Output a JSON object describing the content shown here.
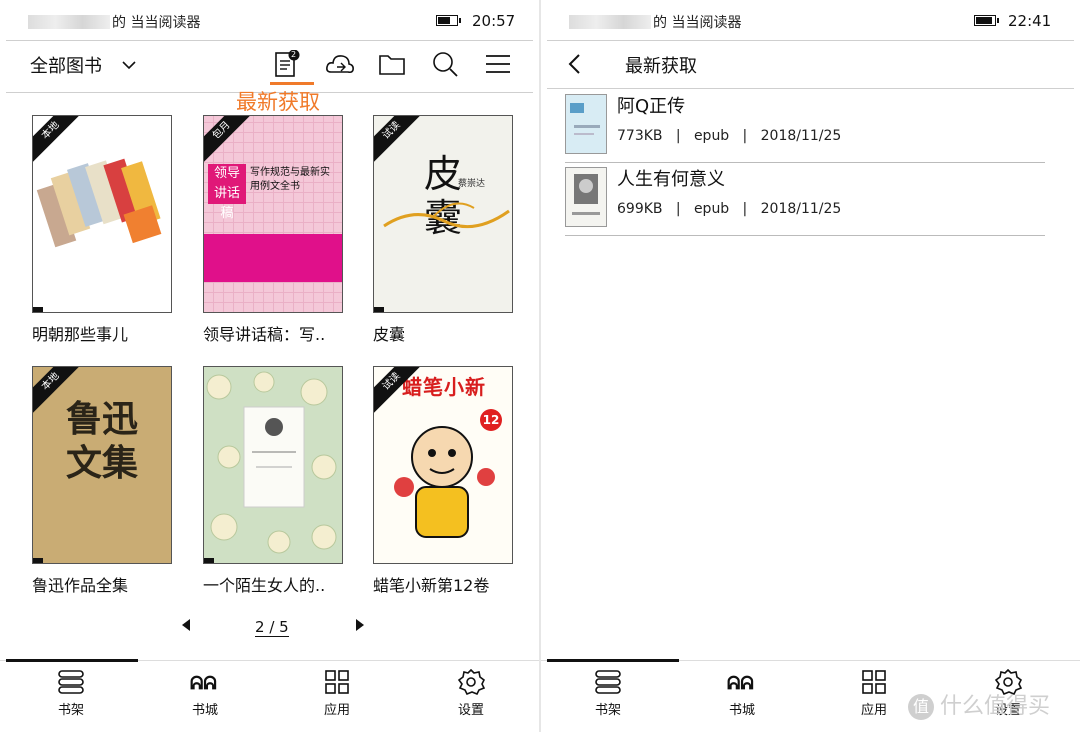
{
  "left": {
    "status": {
      "device": "的 当当阅读器",
      "time": "20:57",
      "battery": 0.75
    },
    "toolbar": {
      "title": "全部图书",
      "notes_badge": "2",
      "icons": [
        "chevron-down-icon",
        "recent-books-icon",
        "cloud-icon",
        "folder-icon",
        "search-icon",
        "menu-icon"
      ]
    },
    "annotation": "最新获取",
    "books": [
      {
        "title": "明朝那些事儿",
        "tag": "本地"
      },
      {
        "title": "领导讲话稿：写..",
        "tag": "包月",
        "cover_big": "领导讲话稿",
        "cover_sub": "写作规范与最新实用例文全书"
      },
      {
        "title": "皮囊",
        "tag": "试读",
        "cover_big": "皮囊",
        "cover_author": "蔡崇达"
      },
      {
        "title": "鲁迅作品全集",
        "tag": "本地",
        "cover_big": "鲁迅文集"
      },
      {
        "title": "一个陌生女人的..",
        "tag": ""
      },
      {
        "title": "蜡笔小新第12卷",
        "tag": "试读",
        "cover_big": "蜡笔小新",
        "cover_num": "12"
      }
    ],
    "pager": {
      "current": "2",
      "total": "5"
    }
  },
  "right": {
    "status": {
      "device": "的 当当阅读器",
      "time": "22:41",
      "battery": 1.0
    },
    "title": "最新获取",
    "items": [
      {
        "title": "阿Q正传",
        "size": "773KB",
        "format": "epub",
        "date": "2018/11/25"
      },
      {
        "title": "人生有何意义",
        "size": "699KB",
        "format": "epub",
        "date": "2018/11/25"
      }
    ]
  },
  "nav": [
    {
      "label": "书架",
      "icon": "bookshelf-icon"
    },
    {
      "label": "书城",
      "icon": "dangdang-store-icon"
    },
    {
      "label": "应用",
      "icon": "apps-grid-icon"
    },
    {
      "label": "设置",
      "icon": "settings-gear-icon"
    }
  ],
  "watermark": {
    "mark": "值",
    "text": "什么值得买"
  }
}
